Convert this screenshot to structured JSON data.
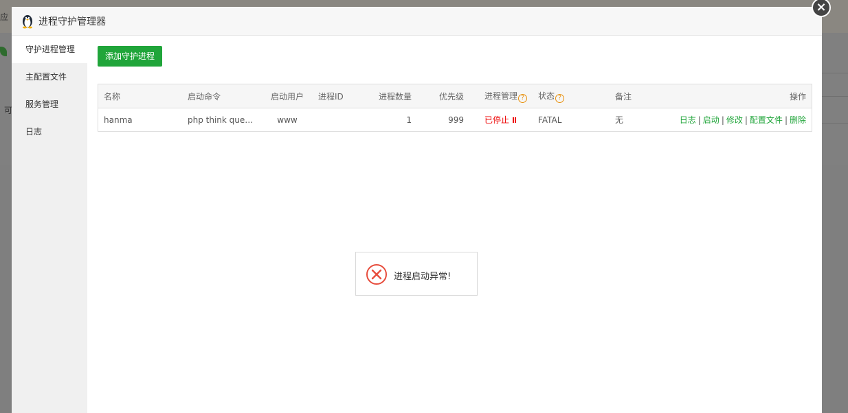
{
  "background": {
    "frag_1": "应",
    "frag_2": "可"
  },
  "dialog": {
    "title": "进程守护管理器",
    "close_label": "×"
  },
  "sidebar": {
    "items": [
      {
        "label": "守护进程管理"
      },
      {
        "label": "主配置文件"
      },
      {
        "label": "服务管理"
      },
      {
        "label": "日志"
      }
    ]
  },
  "main": {
    "add_label": "添加守护进程"
  },
  "table": {
    "headers": {
      "name": "名称",
      "cmd": "启动命令",
      "user": "启动用户",
      "pid": "进程ID",
      "count": "进程数量",
      "priority": "优先级",
      "manage": "进程管理",
      "status": "状态",
      "note": "备注",
      "ops": "操作"
    },
    "help_glyph": "?",
    "rows": [
      {
        "name": "hanma",
        "cmd": "php think queu...",
        "user": "www",
        "pid": "",
        "count": "1",
        "priority": "999",
        "manage": "已停止",
        "status": "FATAL",
        "note": "无",
        "ops": [
          "日志",
          "启动",
          "修改",
          "配置文件",
          "删除"
        ]
      }
    ],
    "separator": "|"
  },
  "toast": {
    "message": "进程启动异常!"
  },
  "colors": {
    "accent": "#20a53a",
    "stopped": "#e00000",
    "help": "#e8900c"
  }
}
